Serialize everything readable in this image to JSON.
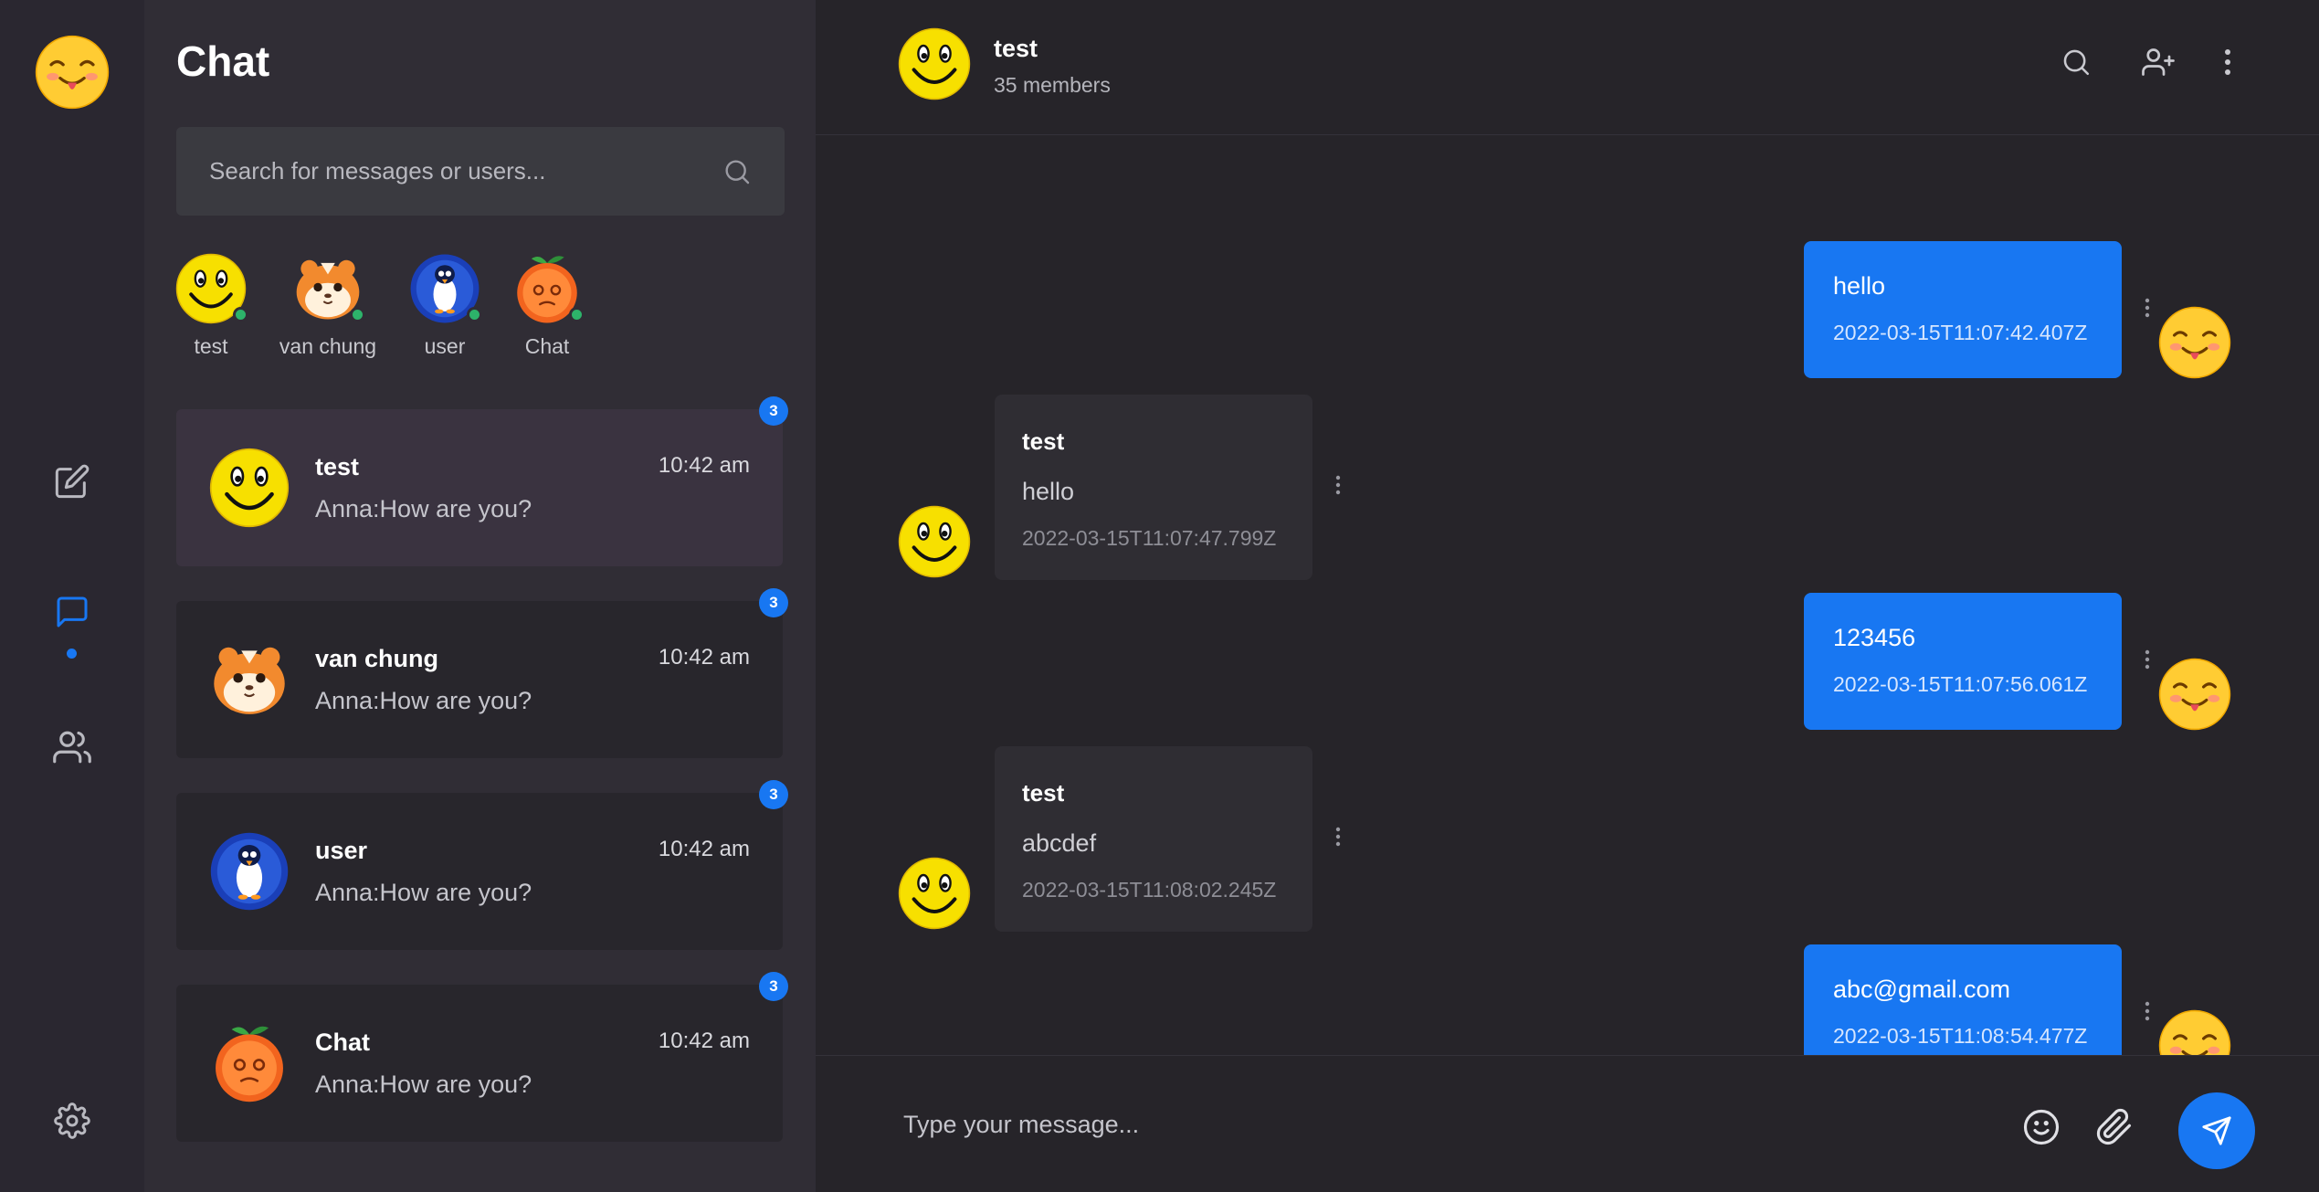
{
  "sidebar": {
    "title": "Chat",
    "search_placeholder": "Search for messages or users...",
    "online_users": [
      {
        "name": "test",
        "avatar": "smiley-face"
      },
      {
        "name": "van chung",
        "avatar": "hamster"
      },
      {
        "name": "user",
        "avatar": "penguin"
      },
      {
        "name": "Chat",
        "avatar": "orange"
      }
    ],
    "conversations": [
      {
        "name": "test",
        "last_message": "Anna:How are you?",
        "time": "10:42 am",
        "unread": "3",
        "avatar": "smiley-face",
        "active": true
      },
      {
        "name": "van chung",
        "last_message": "Anna:How are you?",
        "time": "10:42 am",
        "unread": "3",
        "avatar": "hamster"
      },
      {
        "name": "user",
        "last_message": "Anna:How are you?",
        "time": "10:42 am",
        "unread": "3",
        "avatar": "penguin"
      },
      {
        "name": "Chat",
        "last_message": "Anna:How are you?",
        "time": "10:42 am",
        "unread": "3",
        "avatar": "orange"
      }
    ]
  },
  "rail": {
    "profile_avatar": "tongue-out-emoji",
    "icons": [
      "compose-icon",
      "chat-bubble-icon",
      "users-icon",
      "settings-icon"
    ],
    "active": "chat-bubble-icon"
  },
  "header": {
    "title": "test",
    "subtitle": "35 members",
    "icons": [
      "search-icon",
      "add-user-icon",
      "more-vertical-icon"
    ]
  },
  "messages": [
    {
      "direction": "out",
      "text": "hello",
      "timestamp": "2022-03-15T11:07:42.407Z"
    },
    {
      "direction": "in",
      "sender": "test",
      "text": "hello",
      "timestamp": "2022-03-15T11:07:47.799Z"
    },
    {
      "direction": "out",
      "text": "123456",
      "timestamp": "2022-03-15T11:07:56.061Z"
    },
    {
      "direction": "in",
      "sender": "test",
      "text": "abcdef",
      "timestamp": "2022-03-15T11:08:02.245Z"
    },
    {
      "direction": "out",
      "text": "abc@gmail.com",
      "timestamp": "2022-03-15T11:08:54.477Z"
    }
  ],
  "composer": {
    "placeholder": "Type your message...",
    "icons": [
      "emoji-icon",
      "paperclip-icon",
      "send-icon"
    ]
  },
  "colors": {
    "accent": "#1877f2",
    "online": "#2db36a"
  }
}
